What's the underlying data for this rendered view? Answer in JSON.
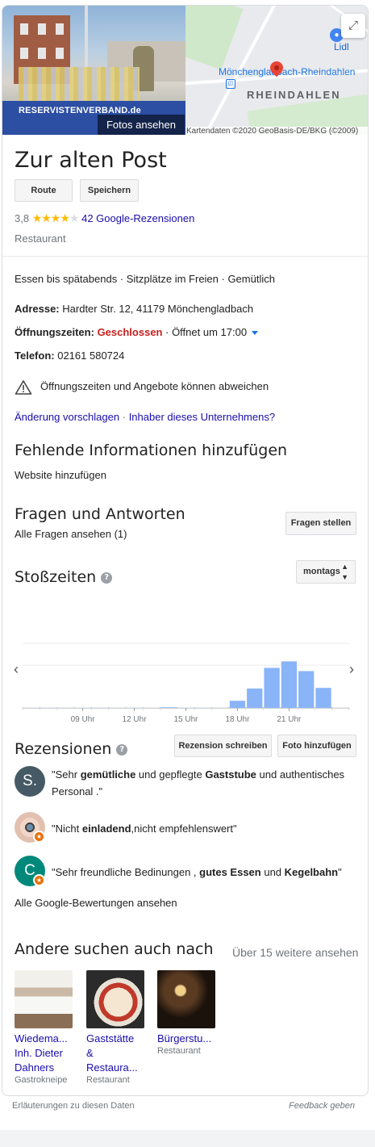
{
  "header": {
    "photo_banner": "RESERVISTENVERBAND.de",
    "photo_caption": "Fotos ansehen",
    "map_poi": "Lidl",
    "map_city": "Mönchengladbach-Rheindahlen",
    "map_district": "RHEINDAHLEN",
    "map_attribution": "Kartendaten ©2020 GeoBasis-DE/BKG (©2009)"
  },
  "place": {
    "name": "Zur alten Post",
    "route_label": "Route",
    "save_label": "Speichern",
    "rating_value": "3,8",
    "stars_full": 4,
    "reviews_link": "42 Google-Rezensionen",
    "category": "Restaurant"
  },
  "info": {
    "highlights": "Essen bis spätabends · Sitzplätze im Freien · Gemütlich",
    "address_label": "Adresse:",
    "address": "Hardter Str. 12, 41179 Mönchengladbach",
    "hours_label": "Öffnungszeiten:",
    "hours_status": "Geschlossen",
    "hours_next": "· Öffnet um 17:00",
    "phone_label": "Telefon:",
    "phone": "02161 580724",
    "warning": "Öffnungszeiten und Angebote können abweichen",
    "suggest_edit": "Änderung vorschlagen",
    "owner_link": "Inhaber dieses Unternehmens?",
    "dot_sep": "·"
  },
  "missing": {
    "title": "Fehlende Informationen hinzufügen",
    "add_website": "Website hinzufügen"
  },
  "qa": {
    "title": "Fragen und Antworten",
    "all_questions": "Alle Fragen ansehen (1)",
    "ask_button": "Fragen stellen"
  },
  "popular": {
    "title": "Stoßzeiten",
    "day_select": "montags"
  },
  "chart_data": {
    "type": "bar",
    "title": "Stoßzeiten",
    "categories": [
      "6",
      "7",
      "8",
      "9",
      "10",
      "11",
      "12",
      "13",
      "14",
      "15",
      "16",
      "17",
      "18",
      "19",
      "20",
      "21",
      "22",
      "23",
      "24"
    ],
    "values": [
      0,
      0,
      0,
      0,
      0,
      0,
      0,
      0,
      1,
      0,
      0,
      0,
      11,
      30,
      62,
      72,
      57,
      31,
      0
    ],
    "tick_labels": [
      "09 Uhr",
      "12 Uhr",
      "15 Uhr",
      "18 Uhr",
      "21 Uhr"
    ],
    "ylim": [
      0,
      100
    ],
    "grid": true
  },
  "reviews": {
    "title": "Rezensionen",
    "write_button": "Rezension schreiben",
    "photo_button": "Foto hinzufügen",
    "all_link": "Alle Google-Bewertungen ansehen",
    "items": [
      {
        "avatar_letter": "S.",
        "avatar_color": "#455a64",
        "parts": [
          {
            "t": "\"Sehr ",
            "b": false
          },
          {
            "t": "gemütliche",
            "b": true
          },
          {
            "t": " und gepflegte ",
            "b": false
          },
          {
            "t": "Gaststube",
            "b": true
          },
          {
            "t": " und authentisches Personal .\"",
            "b": false
          }
        ]
      },
      {
        "avatar_letter": "",
        "avatar_color": "#e2c0b0",
        "parts": [
          {
            "t": "\"Nicht ",
            "b": false
          },
          {
            "t": "einladend",
            "b": true
          },
          {
            "t": ",nicht empfehlenswert\"",
            "b": false
          }
        ]
      },
      {
        "avatar_letter": "C",
        "avatar_color": "#00897b",
        "parts": [
          {
            "t": "\"Sehr freundliche Bedinungen , ",
            "b": false
          },
          {
            "t": "gutes Essen",
            "b": true
          },
          {
            "t": " und ",
            "b": false
          },
          {
            "t": "Kegelbahn",
            "b": true
          },
          {
            "t": "\"",
            "b": false
          }
        ]
      }
    ]
  },
  "others": {
    "title": "Andere suchen auch nach",
    "more_link": "Über 15 weitere ansehen",
    "items": [
      {
        "name_lines": [
          "Wiedema...",
          "Inh. Dieter",
          "Dahners"
        ],
        "type": "Gastrokneipe"
      },
      {
        "name_lines": [
          "Gaststätte",
          "&",
          "Restaura..."
        ],
        "type": "Restaurant"
      },
      {
        "name_lines": [
          "Bürgerstu..."
        ],
        "type": "Restaurant"
      }
    ]
  },
  "footer": {
    "explain": "Erläuterungen zu diesen Daten",
    "feedback": "Feedback geben"
  }
}
